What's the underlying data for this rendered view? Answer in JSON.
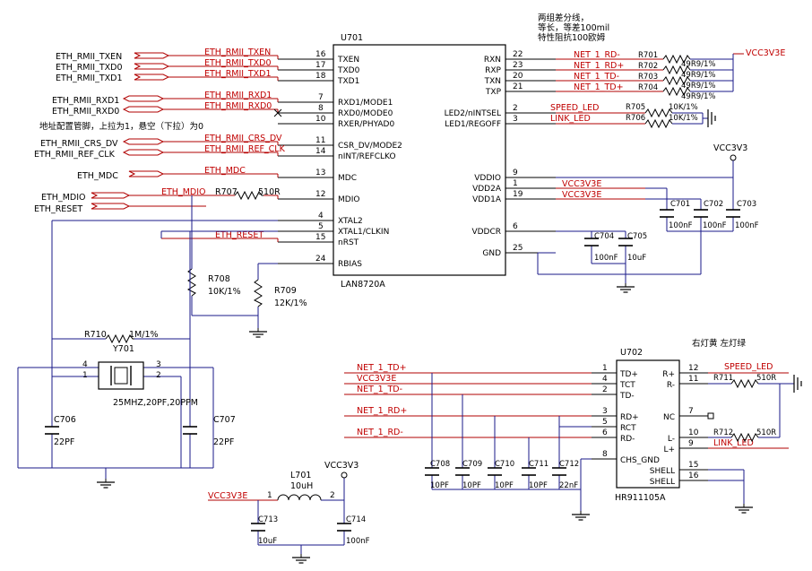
{
  "u701": {
    "ref": "U701",
    "part": "LAN8720A",
    "left_pins": [
      {
        "num": "16",
        "name": "TXEN",
        "net": "ETH_RMII_TXEN"
      },
      {
        "num": "17",
        "name": "TXD0",
        "net": "ETH_RMII_TXD0"
      },
      {
        "num": "18",
        "name": "TXD1",
        "net": "ETH_RMII_TXD1"
      },
      {
        "num": "7",
        "name": "RXD1/MODE1",
        "net": "ETH_RMII_RXD1"
      },
      {
        "num": "8",
        "name": "RXD0/MODE0",
        "net": "ETH_RMII_RXD0"
      },
      {
        "num": "10",
        "name": "RXER/PHYAD0",
        "net": ""
      },
      {
        "num": "11",
        "name": "CSR_DV/MODE2",
        "net": "ETH_RMII_CRS_DV"
      },
      {
        "num": "14",
        "name": "nINT/REFCLKO",
        "net": "ETH_RMII_REF_CLK"
      },
      {
        "num": "13",
        "name": "MDC",
        "net": "ETH_MDC"
      },
      {
        "num": "12",
        "name": "MDIO",
        "net": "ETH_MDIO"
      },
      {
        "num": "4",
        "name": "XTAL2",
        "net": ""
      },
      {
        "num": "5",
        "name": "XTAL1/CLKIN",
        "net": ""
      },
      {
        "num": "15",
        "name": "nRST",
        "net": "ETH_RESET"
      },
      {
        "num": "24",
        "name": "RBIAS",
        "net": ""
      }
    ],
    "right_pins": [
      {
        "num": "22",
        "name": "RXN",
        "net": "NET_1_RD-"
      },
      {
        "num": "23",
        "name": "RXP",
        "net": "NET_1_RD+"
      },
      {
        "num": "20",
        "name": "TXN",
        "net": "NET_1_TD-"
      },
      {
        "num": "21",
        "name": "TXP",
        "net": "NET_1_TD+"
      },
      {
        "num": "2",
        "name": "LED2/nINTSEL",
        "net": "SPEED_LED"
      },
      {
        "num": "3",
        "name": "LED1/REGOFF",
        "net": "LINK_LED"
      },
      {
        "num": "9",
        "name": "VDDIO",
        "net": ""
      },
      {
        "num": "1",
        "name": "VDD2A",
        "net": "VCC3V3E"
      },
      {
        "num": "19",
        "name": "VDD1A",
        "net": "VCC3V3E"
      },
      {
        "num": "6",
        "name": "VDDCR",
        "net": ""
      },
      {
        "num": "25",
        "name": "GND",
        "net": ""
      }
    ]
  },
  "ports_left": [
    "ETH_RMII_TXEN",
    "ETH_RMII_TXD0",
    "ETH_RMII_TXD1",
    "ETH_RMII_RXD1",
    "ETH_RMII_RXD0",
    "ETH_RMII_CRS_DV",
    "ETH_RMII_REF_CLK",
    "ETH_MDC",
    "ETH_MDIO",
    "ETH_RESET"
  ],
  "notes": {
    "pair_top1": "两组差分线，",
    "pair_top2": "等长，等差100mil",
    "pair_top3": "特性阻抗100欧姆",
    "addr": "地址配置管脚，上拉为1，悬空（下拉）为0",
    "led_note": "右灯黄 左灯绿"
  },
  "passives": {
    "R701": {
      "ref": "R701",
      "value": "49R9/1%"
    },
    "R702": {
      "ref": "R702",
      "value": "49R9/1%"
    },
    "R703": {
      "ref": "R703",
      "value": "49R9/1%"
    },
    "R704": {
      "ref": "R704",
      "value": "49R9/1%"
    },
    "R705": {
      "ref": "R705",
      "value": "10K/1%"
    },
    "R706": {
      "ref": "R706",
      "value": "10K/1%"
    },
    "R707": {
      "ref": "R707",
      "value": "510R"
    },
    "R708": {
      "ref": "R708",
      "value": "10K/1%"
    },
    "R709": {
      "ref": "R709",
      "value": "12K/1%"
    },
    "R710": {
      "ref": "R710",
      "value": "1M/1%"
    },
    "R711": {
      "ref": "R711",
      "value": "510R"
    },
    "R712": {
      "ref": "R712",
      "value": "510R"
    },
    "C701": {
      "ref": "C701",
      "value": "100nF"
    },
    "C702": {
      "ref": "C702",
      "value": "100nF"
    },
    "C703": {
      "ref": "C703",
      "value": "100nF"
    },
    "C704": {
      "ref": "C704",
      "value": "100nF"
    },
    "C705": {
      "ref": "C705",
      "value": "10uF"
    },
    "C706": {
      "ref": "C706",
      "value": "22PF"
    },
    "C707": {
      "ref": "C707",
      "value": "22PF"
    },
    "C708": {
      "ref": "C708",
      "value": "10PF"
    },
    "C709": {
      "ref": "C709",
      "value": "10PF"
    },
    "C710": {
      "ref": "C710",
      "value": "10PF"
    },
    "C711": {
      "ref": "C711",
      "value": "10PF"
    },
    "C712": {
      "ref": "C712",
      "value": "22nF"
    },
    "C713": {
      "ref": "C713",
      "value": "10uF"
    },
    "C714": {
      "ref": "C714",
      "value": "100nF"
    },
    "L701": {
      "ref": "L701",
      "value": "10uH"
    },
    "Y701": {
      "ref": "Y701",
      "value": "25MHZ,20PF,20PPM"
    }
  },
  "power": {
    "vcc3v3": "VCC3V3",
    "vcc3v3e": "VCC3V3E"
  },
  "u702": {
    "ref": "U702",
    "part": "HR911105A",
    "left_pins": [
      {
        "num": "1",
        "name": "TD+",
        "net": "NET_1_TD+"
      },
      {
        "num": "4",
        "name": "TCT",
        "net": "VCC3V3E"
      },
      {
        "num": "2",
        "name": "TD-",
        "net": "NET_1_TD-"
      },
      {
        "num": "3",
        "name": "RD+",
        "net": "NET_1_RD+"
      },
      {
        "num": "5",
        "name": "RCT",
        "net": ""
      },
      {
        "num": "6",
        "name": "RD-",
        "net": "NET_1_RD-"
      },
      {
        "num": "8",
        "name": "CHS_GND",
        "net": ""
      }
    ],
    "right_pins": [
      {
        "num": "12",
        "name": "R+",
        "net": "SPEED_LED"
      },
      {
        "num": "11",
        "name": "R-",
        "net": ""
      },
      {
        "num": "7",
        "name": "NC",
        "net": ""
      },
      {
        "num": "10",
        "name": "L-",
        "net": ""
      },
      {
        "num": "9",
        "name": "L+",
        "net": "LINK_LED"
      },
      {
        "num": "15",
        "name": "SHELL",
        "net": ""
      },
      {
        "num": "16",
        "name": "SHELL",
        "net": ""
      }
    ]
  },
  "l701_pins": {
    "p1": "1",
    "p2": "2"
  },
  "y701_pins": {
    "p1": "1",
    "p2": "2",
    "p3": "3",
    "p4": "4"
  }
}
